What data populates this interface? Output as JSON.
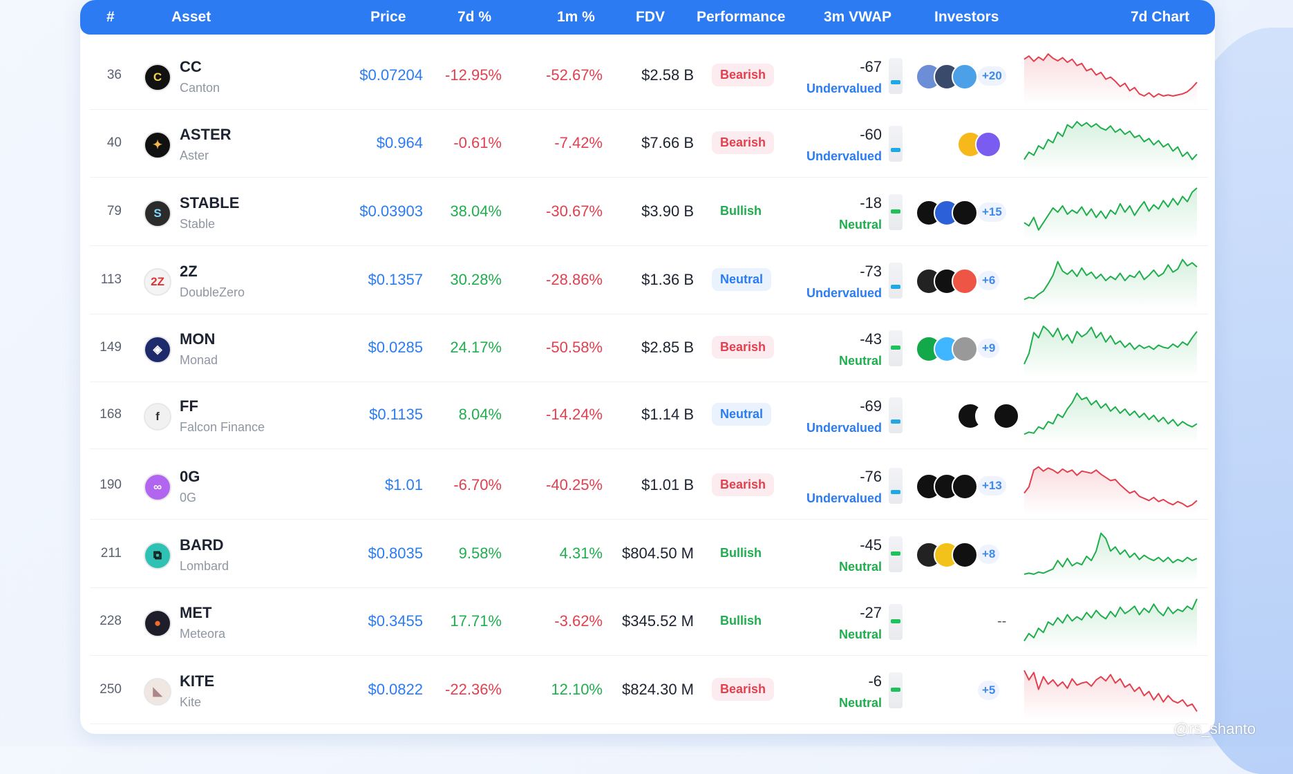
{
  "header": {
    "rank": "#",
    "asset": "Asset",
    "price": "Price",
    "d7": "7d %",
    "m1": "1m %",
    "fdv": "FDV",
    "performance": "Performance",
    "vwap": "3m VWAP",
    "investors": "Investors",
    "chart": "7d Chart"
  },
  "colors": {
    "accent": "#2c7bf2",
    "negative": "#e2404f",
    "positive": "#1fae4d",
    "neutral_badge": "#2b7cf1"
  },
  "rows": [
    {
      "rank": "36",
      "ticker": "CC",
      "name": "Canton",
      "price": "$0.07204",
      "d7": "-12.95%",
      "m1": "-52.67%",
      "fdv": "$2.58 B",
      "perf": "Bearish",
      "vwap": "-67",
      "vwap_label": "Undervalued",
      "more": "+20",
      "trend": "down",
      "logo": "C",
      "spark": [
        82,
        88,
        78,
        86,
        80,
        92,
        84,
        79,
        85,
        76,
        82,
        70,
        74,
        60,
        64,
        52,
        57,
        44,
        48,
        40,
        30,
        36,
        22,
        28,
        16,
        12,
        18,
        10,
        16,
        12,
        14,
        12,
        14,
        16,
        20,
        28,
        38
      ]
    },
    {
      "rank": "40",
      "ticker": "ASTER",
      "name": "Aster",
      "price": "$0.964",
      "d7": "-0.61%",
      "m1": "-7.42%",
      "fdv": "$7.66 B",
      "perf": "Bearish",
      "vwap": "-60",
      "vwap_label": "Undervalued",
      "more": "",
      "trend": "up",
      "logo": "✦",
      "spark": [
        20,
        34,
        28,
        46,
        40,
        58,
        52,
        72,
        64,
        86,
        80,
        92,
        84,
        90,
        82,
        88,
        80,
        76,
        84,
        72,
        78,
        68,
        74,
        62,
        66,
        54,
        60,
        48,
        56,
        44,
        50,
        36,
        44,
        26,
        34,
        20,
        30
      ]
    },
    {
      "rank": "79",
      "ticker": "STABLE",
      "name": "Stable",
      "price": "$0.03903",
      "d7": "38.04%",
      "m1": "-30.67%",
      "fdv": "$3.90 B",
      "perf": "Bullish",
      "vwap": "-18",
      "vwap_label": "Neutral",
      "more": "+15",
      "trend": "up",
      "logo": "S",
      "spark": [
        30,
        24,
        40,
        16,
        30,
        44,
        58,
        50,
        62,
        46,
        54,
        48,
        60,
        44,
        56,
        40,
        52,
        38,
        54,
        46,
        66,
        50,
        62,
        44,
        58,
        70,
        52,
        64,
        56,
        72,
        60,
        76,
        64,
        80,
        70,
        88,
        96
      ]
    },
    {
      "rank": "113",
      "ticker": "2Z",
      "name": "DoubleZero",
      "price": "$0.1357",
      "d7": "30.28%",
      "m1": "-28.86%",
      "fdv": "$1.36 B",
      "perf": "Neutral",
      "vwap": "-73",
      "vwap_label": "Undervalued",
      "more": "+6",
      "trend": "up",
      "logo": "2Z",
      "spark": [
        14,
        18,
        16,
        24,
        30,
        44,
        60,
        86,
        68,
        62,
        70,
        58,
        74,
        60,
        66,
        54,
        62,
        50,
        58,
        52,
        64,
        50,
        60,
        56,
        68,
        52,
        60,
        70,
        58,
        64,
        80,
        66,
        72,
        90,
        78,
        84,
        76
      ]
    },
    {
      "rank": "149",
      "ticker": "MON",
      "name": "Monad",
      "price": "$0.0285",
      "d7": "24.17%",
      "m1": "-50.58%",
      "fdv": "$2.85 B",
      "perf": "Bearish",
      "vwap": "-43",
      "vwap_label": "Neutral",
      "more": "+9",
      "trend": "up",
      "logo": "◈",
      "spark": [
        20,
        40,
        80,
        70,
        92,
        84,
        72,
        88,
        66,
        76,
        60,
        82,
        72,
        78,
        90,
        70,
        80,
        62,
        74,
        58,
        64,
        52,
        60,
        48,
        56,
        50,
        54,
        48,
        56,
        52,
        50,
        58,
        52,
        62,
        56,
        70,
        82
      ]
    },
    {
      "rank": "168",
      "ticker": "FF",
      "name": "Falcon Finance",
      "price": "$0.1135",
      "d7": "8.04%",
      "m1": "-14.24%",
      "fdv": "$1.14 B",
      "perf": "Neutral",
      "vwap": "-69",
      "vwap_label": "Undervalued",
      "more": "",
      "trend": "up",
      "logo": "f",
      "spark": [
        14,
        18,
        16,
        28,
        24,
        38,
        34,
        52,
        46,
        62,
        74,
        92,
        80,
        84,
        70,
        78,
        64,
        72,
        58,
        66,
        54,
        62,
        50,
        58,
        46,
        54,
        42,
        50,
        38,
        46,
        34,
        42,
        30,
        38,
        32,
        28,
        34
      ]
    },
    {
      "rank": "190",
      "ticker": "0G",
      "name": "0G",
      "price": "$1.01",
      "d7": "-6.70%",
      "m1": "-40.25%",
      "fdv": "$1.01 B",
      "perf": "Bearish",
      "vwap": "-76",
      "vwap_label": "Undervalued",
      "more": "+13",
      "trend": "down",
      "logo": "∞",
      "spark": [
        36,
        48,
        80,
        86,
        78,
        84,
        80,
        74,
        82,
        76,
        80,
        70,
        78,
        76,
        74,
        80,
        72,
        66,
        60,
        62,
        52,
        44,
        36,
        40,
        30,
        26,
        22,
        28,
        20,
        24,
        18,
        14,
        20,
        16,
        10,
        14,
        22
      ]
    },
    {
      "rank": "211",
      "ticker": "BARD",
      "name": "Lombard",
      "price": "$0.8035",
      "d7": "9.58%",
      "m1": "4.31%",
      "fdv": "$804.50 M",
      "perf": "Bullish",
      "vwap": "-45",
      "vwap_label": "Neutral",
      "more": "+8",
      "trend": "up",
      "logo": "⧉",
      "spark": [
        12,
        14,
        12,
        16,
        14,
        18,
        22,
        38,
        26,
        42,
        28,
        34,
        30,
        46,
        38,
        56,
        90,
        80,
        56,
        64,
        50,
        58,
        44,
        52,
        40,
        48,
        42,
        38,
        44,
        36,
        44,
        34,
        40,
        36,
        44,
        38,
        42
      ]
    },
    {
      "rank": "228",
      "ticker": "MET",
      "name": "Meteora",
      "price": "$0.3455",
      "d7": "17.71%",
      "m1": "-3.62%",
      "fdv": "$345.52 M",
      "perf": "Bullish",
      "vwap": "-27",
      "vwap_label": "Neutral",
      "more": "",
      "trend": "up",
      "logo": "●",
      "spark": [
        14,
        28,
        20,
        38,
        30,
        50,
        44,
        58,
        48,
        64,
        52,
        60,
        54,
        68,
        58,
        72,
        62,
        56,
        70,
        60,
        78,
        66,
        72,
        80,
        64,
        76,
        68,
        84,
        70,
        62,
        78,
        66,
        74,
        70,
        80,
        74,
        94
      ]
    },
    {
      "rank": "250",
      "ticker": "KITE",
      "name": "Kite",
      "price": "$0.0822",
      "d7": "-22.36%",
      "m1": "12.10%",
      "fdv": "$824.30 M",
      "perf": "Bearish",
      "vwap": "-6",
      "vwap_label": "Neutral",
      "more": "+5",
      "trend": "down",
      "logo": "◣",
      "spark": [
        88,
        70,
        84,
        52,
        76,
        62,
        70,
        58,
        66,
        54,
        72,
        60,
        64,
        66,
        58,
        70,
        76,
        68,
        80,
        64,
        72,
        56,
        62,
        48,
        56,
        40,
        48,
        32,
        44,
        28,
        40,
        30,
        26,
        32,
        20,
        24,
        10
      ]
    }
  ],
  "no_investors_placeholder": "--",
  "watermark": "@rs_shanto"
}
